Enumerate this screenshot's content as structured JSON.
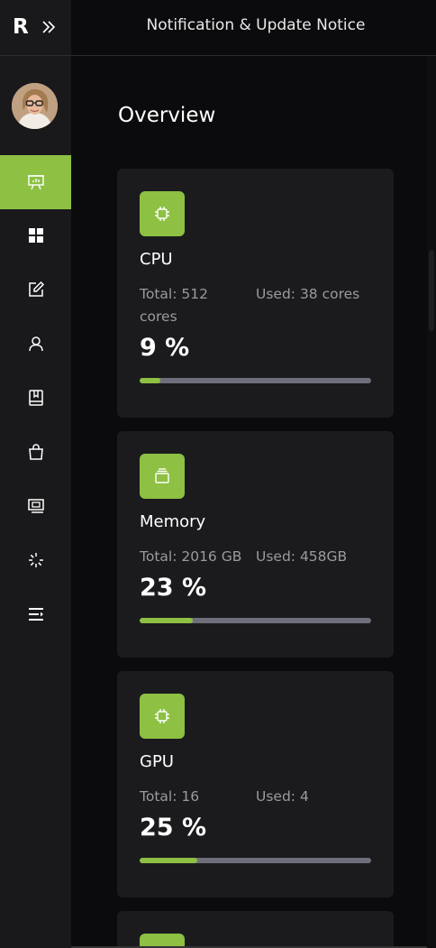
{
  "app": {
    "logo_letter": "R",
    "header_title": "Notification & Update Notice"
  },
  "sidebar": {
    "items": [
      {
        "icon": "presentation-icon",
        "active": true
      },
      {
        "icon": "grid-icon",
        "active": false
      },
      {
        "icon": "edit-icon",
        "active": false
      },
      {
        "icon": "user-icon",
        "active": false
      },
      {
        "icon": "book-icon",
        "active": false
      },
      {
        "icon": "shopping-bag-icon",
        "active": false
      },
      {
        "icon": "monitor-icon",
        "active": false
      },
      {
        "icon": "loader-icon",
        "active": false
      },
      {
        "icon": "list-icon",
        "active": false
      }
    ]
  },
  "overview": {
    "title": "Overview",
    "cards": [
      {
        "name": "CPU",
        "total": "Total: 512 cores",
        "used": "Used: 38 cores",
        "percent_label": "9 %",
        "percent": 9,
        "icon": "chip-icon"
      },
      {
        "name": "Memory",
        "total": "Total: 2016 GB",
        "used": "Used: 458GB",
        "percent_label": "23 %",
        "percent": 23,
        "icon": "memory-icon"
      },
      {
        "name": "GPU",
        "total": "Total: 16",
        "used": "Used: 4",
        "percent_label": "25 %",
        "percent": 25,
        "icon": "chip-icon"
      }
    ]
  },
  "colors": {
    "accent": "#8dc043",
    "background": "#0b0b0d",
    "sidebar": "#19191b",
    "card": "#1b1b1e"
  }
}
